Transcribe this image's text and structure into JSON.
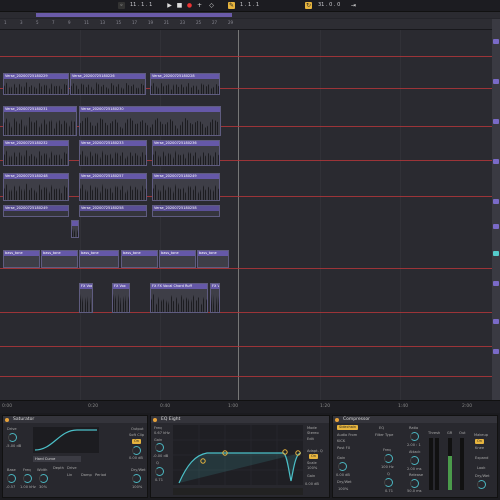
{
  "transport": {
    "tempo": "11 . 1 . 1",
    "loop_start": "1 . 1 . 1",
    "position": "31 . 0 . 0"
  },
  "ruler": [
    "1",
    "3",
    "5",
    "7",
    "9",
    "11",
    "13",
    "15",
    "17",
    "19",
    "21",
    "23",
    "25",
    "27",
    "29"
  ],
  "clips": {
    "verse_a": "Verse_20200725180229",
    "verse_b": "Verse_20200725180226",
    "verse_c": "Verse_20200725180228",
    "verse_d": "Verse_20200725180231",
    "verse_e": "Verse_20200725180230",
    "verse_f": "Verse_20200725180232",
    "verse_g": "Verse_20200725180233",
    "verse_h": "Verse_20200725180236",
    "verse_i": "Verse_20200725180248",
    "verse_j": "Verse_20200725180257",
    "verse_k": "Verse_20200725180249",
    "verse_l": "Verse_20200725180258",
    "bass_tone": "bass_tone",
    "fx_vox": "FX Vox",
    "fx_vocal": "FX FX Vocal Chord Ruff"
  },
  "timebar": [
    "0:00",
    "0:20",
    "0:40",
    "1:00",
    "1:20",
    "1:40",
    "2:00"
  ],
  "devices": {
    "saturator": {
      "title": "Saturator",
      "drive": "Drive",
      "drive_val": "-5.00 dB",
      "curve": "Hard Curve",
      "output": "Output",
      "output_val": "0.00 dB",
      "soft_clip": "Soft Clip",
      "base": "Base",
      "freq": "Freq",
      "width": "Width",
      "depth": "Depth",
      "lin": "Lin",
      "damp": "Damp",
      "period": "Period",
      "dry_wet": "Dry/Wet",
      "base_val": "-0.57",
      "freq_val": "1.00 kHz",
      "width_val": "30%",
      "dw_val": "100%"
    },
    "eq_eight": {
      "title": "EQ Eight",
      "freq": "Freq",
      "freq_val": "0.67 kHz",
      "gain": "Gain",
      "gain_val": "-0.00 dB",
      "q": "Q",
      "q_val": "0.71",
      "mode": "Mode",
      "mode_val": "Stereo",
      "edit": "Edit",
      "adapt_q": "Adapt. Q",
      "on": "On",
      "scale": "Scale",
      "scale_val": "100%",
      "gain_out": "Gain",
      "gain_out_val": "0.00 dB"
    },
    "compressor": {
      "title": "Compressor",
      "sidechain": "Sidechain",
      "eq": "EQ",
      "audio_from": "Audio From",
      "kick": "KICK",
      "post_fx": "Post FX",
      "filter_type": "Filter Type",
      "freq": "Freq",
      "freq_val": "100 Hz",
      "q": "Q",
      "q_val": "0.71",
      "gain": "Gain",
      "gain_val": "0.00 dB",
      "dry_wet": "Dry/Wet",
      "dw_val": "100%",
      "ratio": "Ratio",
      "ratio_val": "2.00 : 1",
      "attack": "Attack",
      "attack_val": "2.00 ms",
      "release": "Release",
      "release_val": "50.0 ms",
      "auto": "Auto",
      "thresh": "Thresh",
      "gr": "GR",
      "out": "Out",
      "makeup": "Makeup",
      "knee": "Knee",
      "expand": "Expand",
      "look": "Look",
      "dry_wet2": "Dry/Wet"
    }
  }
}
